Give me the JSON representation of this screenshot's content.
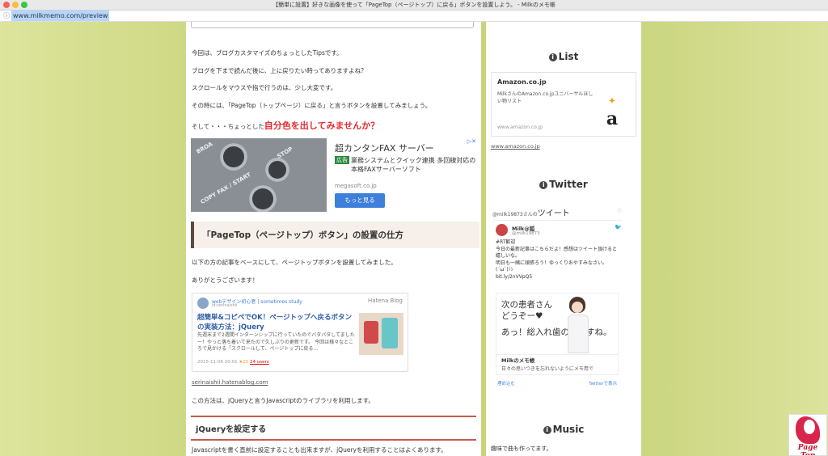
{
  "window": {
    "title": "【簡単に設置】好きな画像を使って「PageTop（ページトップ）に戻る」ボタンを設置しよう。 - Milkのメモ帳",
    "url": "www.milkmemo.com/preview",
    "info_icon": "info-icon"
  },
  "article": {
    "paragraphs": [
      "今回は、ブログカスタマイズのちょっとしたTipsです。",
      "ブログを下まで読んだ後に、上に戻りたい時ってありますよね？",
      "スクロールをマウスや指で行うのは、少し大変です。",
      "その時には、「PageTop（トップページ）に戻る」と言うボタンを設置してみましょう。"
    ],
    "emphasis_prefix": "そして・・・ちょっとした",
    "emphasis": "自分色を出してみませんか？",
    "ad": {
      "title": "超カンタンFAX サーバー",
      "tag": "広告",
      "text": "業務システムとクイック連携 多回線対応の本格FAXサーバーソフト",
      "domain": "megasoft.co.jp",
      "button": "もっと見る",
      "image_labels": [
        "BROA",
        "STOP",
        "COPY FAX / START"
      ]
    },
    "heading1": "「PageTop（ページトップ）ボタン」の設置の仕方",
    "para2": "以下の方の記事をベースにして、ページトップボタンを設置してみました。",
    "para3": "ありがとうございます！",
    "blogcard": {
      "site": "webデザイン初心者 | sometimes study",
      "sub": "id:serinaishii",
      "service": "Hatena Blog",
      "title": "超簡単&コピペでOK！ページトップへ戻るボタンの実装方法：jQuery",
      "desc": "先週末まで2週間インターンシップに行っていたのでバタバタしてましたー！やっと落ち着いて来たので久しぶりの更新です。 今回は様々なところで見かける「スクロールして、ページトップに戻る…",
      "date": "2015-11-06 20:01",
      "stars": "★15",
      "users": "24 users"
    },
    "link": "serinaishii.hatenablog.com",
    "para4": "この方法は、jQueryと言うJavascriptのライブラリを利用します。",
    "heading2": "jQueryを設定する",
    "para5": "Javascriptを書く直前に設定することも出来ますが、jQueryを利用することはよくあります。"
  },
  "sidebar": {
    "list_title": "List",
    "amazon": {
      "name": "Amazon.co.jp",
      "desc": "MilkさんのAmazon.co.jpユニバーサルほしい物リスト",
      "footer": "www.amazon.co.jp",
      "logo": "a"
    },
    "amazon_link": "www.amazon.co.jp",
    "twitter_title": "Twitter",
    "twitter": {
      "header_prefix": "@milk19873さんの",
      "header_main": "ツイート",
      "user": "Milk@狐",
      "handle": "@milk19873",
      "body": "#RT歓迎\n今日の最新記事はこちらだよ！感想はツイート頂けると嬉しいな。\n明日も一緒に頑張ろう！ゆっくりおやすみなさい。(´ω`)ﾉｼ\nbit.ly/2nVVpQ5",
      "media_text1": "次の患者さん",
      "media_text2": "どうぞー♥",
      "media_text3": "あっ！総入れ歯の方ですね。",
      "card_title": "Milkのメモ帳",
      "card_desc": "日々の思いつきを忘れないようにメモ用で",
      "embed": "埋め込む",
      "view": "Twitterで表示"
    },
    "music_title": "Music",
    "music_text": "趣味で曲も作ってます。"
  },
  "pagetop": {
    "label": "Page Top"
  }
}
